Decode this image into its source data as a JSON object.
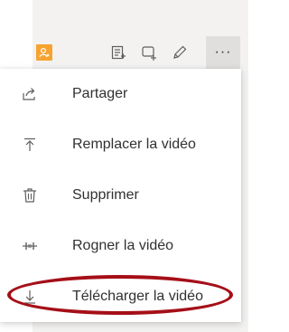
{
  "toolbar": {
    "avatar_icon": "user-badge-icon",
    "avatar_color": "#f7a330",
    "icons": [
      "notes-list-icon",
      "add-frame-icon",
      "pencil-icon"
    ],
    "more_label": "···"
  },
  "menu": {
    "items": [
      {
        "label": "Partager",
        "icon": "share-icon"
      },
      {
        "label": "Remplacer la vidéo",
        "icon": "upload-arrow-icon"
      },
      {
        "label": "Supprimer",
        "icon": "trash-icon"
      },
      {
        "label": "Rogner la vidéo",
        "icon": "trim-icon"
      },
      {
        "label": "Télécharger la vidéo",
        "icon": "download-arrow-icon"
      }
    ]
  },
  "annotation": {
    "highlight_color": "#a50f18",
    "highlighted_item": "Télécharger la vidéo"
  }
}
